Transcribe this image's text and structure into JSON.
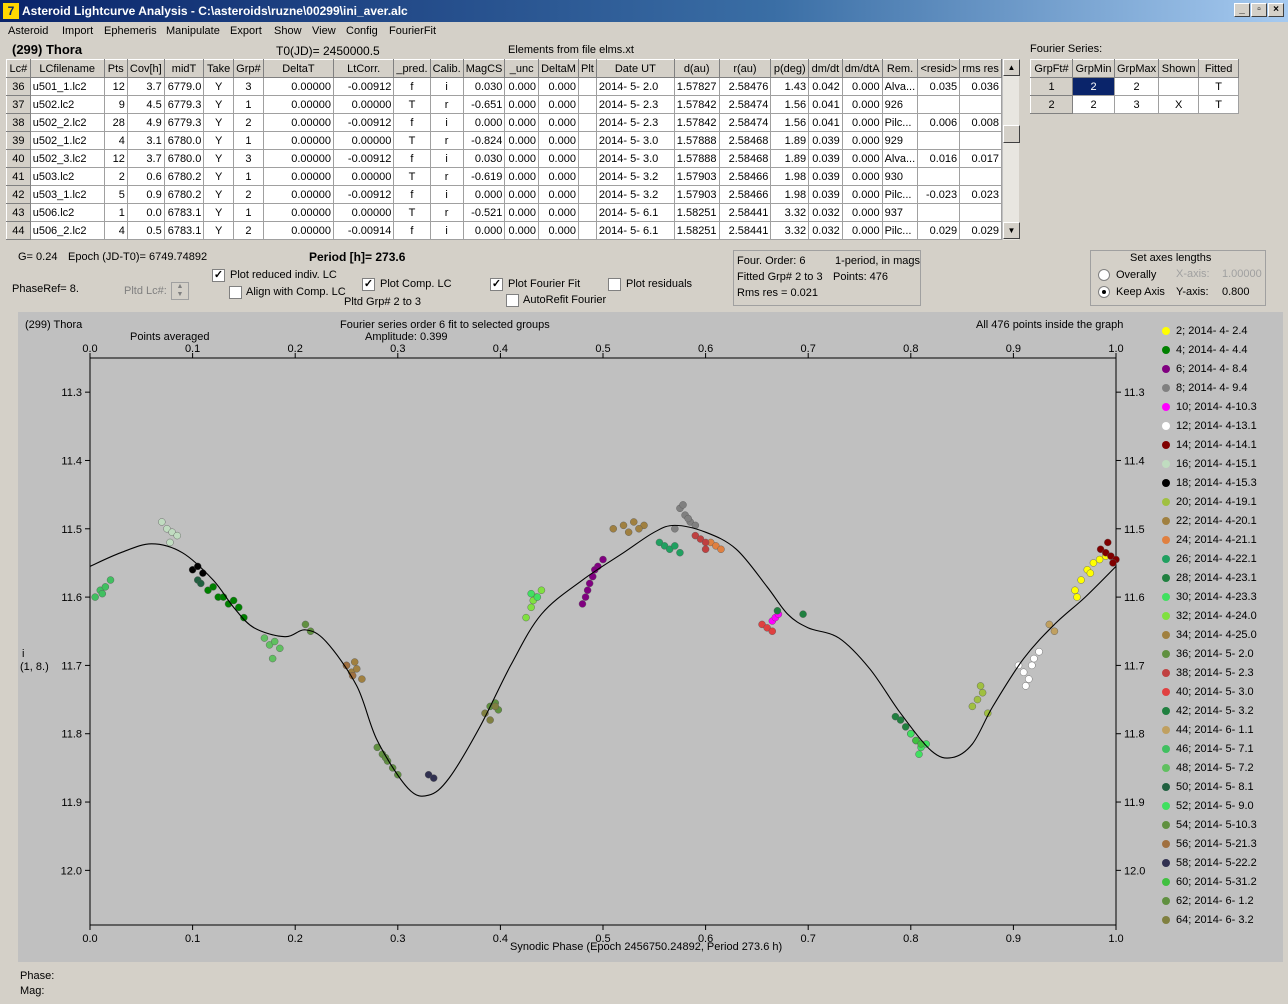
{
  "window": {
    "title": "Asteroid Lightcurve Analysis - C:\\asteroids\\ruzne\\00299\\ini_aver.alc",
    "min": "_",
    "max": "▫",
    "close": "×"
  },
  "menu": [
    "Asteroid",
    "Import",
    "Ephemeris",
    "Manipulate",
    "Export",
    "Show",
    "View",
    "Config",
    "FourierFit"
  ],
  "header": {
    "asteroid": "(299) Thora",
    "t0": "T0(JD)= 2450000.5",
    "elements": "Elements from file elms.xt"
  },
  "table": {
    "columns": [
      "Lc#",
      "LCfilename",
      "Pts",
      "Cov[h]",
      "midT",
      "Take",
      "Grp#",
      "DeltaT",
      "LtCorr.",
      "_pred.",
      "Calib.",
      "MagCS",
      "_unc",
      "DeltaM",
      "Plt",
      "Date UT",
      "d(au)",
      "r(au)",
      "p(deg)",
      "dm/dt",
      "dm/dtA",
      "Rem.",
      "<resid>",
      "rms res"
    ],
    "rows": [
      [
        "36",
        "u501_1.lc2",
        "12",
        "3.7",
        "6779.0",
        "Y",
        "3",
        "0.00000",
        "-0.00912",
        "f",
        "i",
        "0.030",
        "0.000",
        "0.000",
        "",
        "2014- 5- 2.0",
        "1.57827",
        "2.58476",
        "1.43",
        "0.042",
        "0.000",
        "Alva...",
        "0.035",
        "0.036"
      ],
      [
        "37",
        "u502.lc2",
        "9",
        "4.5",
        "6779.3",
        "Y",
        "1",
        "0.00000",
        "0.00000",
        "T",
        "r",
        "-0.651",
        "0.000",
        "0.000",
        "",
        "2014- 5- 2.3",
        "1.57842",
        "2.58474",
        "1.56",
        "0.041",
        "0.000",
        "926",
        "",
        ""
      ],
      [
        "38",
        "u502_2.lc2",
        "28",
        "4.9",
        "6779.3",
        "Y",
        "2",
        "0.00000",
        "-0.00912",
        "f",
        "i",
        "0.000",
        "0.000",
        "0.000",
        "",
        "2014- 5- 2.3",
        "1.57842",
        "2.58474",
        "1.56",
        "0.041",
        "0.000",
        "Pilc...",
        "0.006",
        "0.008"
      ],
      [
        "39",
        "u502_1.lc2",
        "4",
        "3.1",
        "6780.0",
        "Y",
        "1",
        "0.00000",
        "0.00000",
        "T",
        "r",
        "-0.824",
        "0.000",
        "0.000",
        "",
        "2014- 5- 3.0",
        "1.57888",
        "2.58468",
        "1.89",
        "0.039",
        "0.000",
        "929",
        "",
        ""
      ],
      [
        "40",
        "u502_3.lc2",
        "12",
        "3.7",
        "6780.0",
        "Y",
        "3",
        "0.00000",
        "-0.00912",
        "f",
        "i",
        "0.030",
        "0.000",
        "0.000",
        "",
        "2014- 5- 3.0",
        "1.57888",
        "2.58468",
        "1.89",
        "0.039",
        "0.000",
        "Alva...",
        "0.016",
        "0.017"
      ],
      [
        "41",
        "u503.lc2",
        "2",
        "0.6",
        "6780.2",
        "Y",
        "1",
        "0.00000",
        "0.00000",
        "T",
        "r",
        "-0.619",
        "0.000",
        "0.000",
        "",
        "2014- 5- 3.2",
        "1.57903",
        "2.58466",
        "1.98",
        "0.039",
        "0.000",
        "930",
        "",
        ""
      ],
      [
        "42",
        "u503_1.lc2",
        "5",
        "0.9",
        "6780.2",
        "Y",
        "2",
        "0.00000",
        "-0.00912",
        "f",
        "i",
        "0.000",
        "0.000",
        "0.000",
        "",
        "2014- 5- 3.2",
        "1.57903",
        "2.58466",
        "1.98",
        "0.039",
        "0.000",
        "Pilc...",
        "-0.023",
        "0.023"
      ],
      [
        "43",
        "u506.lc2",
        "1",
        "0.0",
        "6783.1",
        "Y",
        "1",
        "0.00000",
        "0.00000",
        "T",
        "r",
        "-0.521",
        "0.000",
        "0.000",
        "",
        "2014- 5- 6.1",
        "1.58251",
        "2.58441",
        "3.32",
        "0.032",
        "0.000",
        "937",
        "",
        ""
      ],
      [
        "44",
        "u506_2.lc2",
        "4",
        "0.5",
        "6783.1",
        "Y",
        "2",
        "0.00000",
        "-0.00914",
        "f",
        "i",
        "0.000",
        "0.000",
        "0.000",
        "",
        "2014- 5- 6.1",
        "1.58251",
        "2.58441",
        "3.32",
        "0.032",
        "0.000",
        "Pilc...",
        "0.029",
        "0.029"
      ]
    ]
  },
  "fourier": {
    "title": "Fourier Series:",
    "columns": [
      "GrpFt#",
      "GrpMin",
      "GrpMax",
      "Shown",
      "Fitted"
    ],
    "rows": [
      [
        "1",
        "2",
        "2",
        "",
        "T"
      ],
      [
        "2",
        "2",
        "3",
        "X",
        "T"
      ]
    ]
  },
  "params": {
    "g": "G= 0.24",
    "epoch": "Epoch (JD-T0)= 6749.74892",
    "period": "Period [h]= 273.6",
    "phaseref": "PhaseRef= 8.",
    "pltd_lc": "Pltd Lc#:",
    "plot_reduced": "Plot reduced indiv. LC",
    "align": "Align with Comp. LC",
    "plot_comp": "Plot Comp. LC",
    "pltd_grp": "Pltd Grp#  2   to    3",
    "plot_fourier": "Plot Fourier Fit",
    "autorefit": "AutoRefit Fourier",
    "plot_resid": "Plot residuals",
    "check_plot_reduced": true,
    "check_align": false,
    "check_plot_comp": true,
    "check_plot_fourier": true,
    "check_autorefit": false,
    "check_plot_resid": false
  },
  "fitinfo": {
    "order": "Four. Order:  6",
    "oneperiod": "1-period, in mags",
    "fitted": "Fitted Grp# 2 to 3",
    "points": "Points: 476",
    "rms": "Rms res    = 0.021"
  },
  "axes": {
    "title": "Set axes lengths",
    "overally": "Overally",
    "keep": "Keep Axis",
    "xaxis": "X-axis:",
    "xval": "1.00000",
    "yaxis": "Y-axis:",
    "yval": "0.800",
    "selected": "keep"
  },
  "chart_data": {
    "type": "scatter",
    "title": "Fourier series order 6 fit to selected groups",
    "subtitle": "Amplitude: 0.399",
    "name": "(299) Thora",
    "note_left": "Points averaged",
    "note_right": "All 476 points inside the graph",
    "xlabel": "Synodic Phase (Epoch 2456750.24892, Period 273.6 h)",
    "ylabel": "i",
    "ylabel2": "(1, 8.)",
    "xlim": [
      0,
      1
    ],
    "ylim": [
      11.25,
      12.08
    ],
    "y_reversed": true,
    "xticks": [
      0.0,
      0.1,
      0.2,
      0.3,
      0.4,
      0.5,
      0.6,
      0.7,
      0.8,
      0.9,
      1.0
    ],
    "yticks": [
      11.3,
      11.4,
      11.5,
      11.6,
      11.7,
      11.8,
      11.9,
      12.0
    ],
    "fit_curve": [
      [
        0,
        11.555
      ],
      [
        0.03,
        11.535
      ],
      [
        0.06,
        11.522
      ],
      [
        0.09,
        11.535
      ],
      [
        0.12,
        11.575
      ],
      [
        0.14,
        11.615
      ],
      [
        0.16,
        11.645
      ],
      [
        0.19,
        11.658
      ],
      [
        0.21,
        11.648
      ],
      [
        0.23,
        11.665
      ],
      [
        0.26,
        11.73
      ],
      [
        0.28,
        11.81
      ],
      [
        0.31,
        11.88
      ],
      [
        0.33,
        11.89
      ],
      [
        0.35,
        11.865
      ],
      [
        0.38,
        11.79
      ],
      [
        0.41,
        11.7
      ],
      [
        0.44,
        11.625
      ],
      [
        0.48,
        11.575
      ],
      [
        0.52,
        11.535
      ],
      [
        0.55,
        11.505
      ],
      [
        0.57,
        11.495
      ],
      [
        0.6,
        11.505
      ],
      [
        0.63,
        11.53
      ],
      [
        0.66,
        11.585
      ],
      [
        0.68,
        11.625
      ],
      [
        0.7,
        11.645
      ],
      [
        0.73,
        11.66
      ],
      [
        0.76,
        11.705
      ],
      [
        0.79,
        11.77
      ],
      [
        0.82,
        11.825
      ],
      [
        0.84,
        11.835
      ],
      [
        0.86,
        11.815
      ],
      [
        0.88,
        11.76
      ],
      [
        0.91,
        11.69
      ],
      [
        0.94,
        11.64
      ],
      [
        0.97,
        11.6
      ],
      [
        1.0,
        11.555
      ]
    ],
    "series": [
      {
        "name": "2; 2014- 4- 2.4",
        "color": "#ffff00",
        "x": [
          0.96,
          0.966,
          0.972,
          0.978,
          0.984,
          0.99,
          0.962,
          0.975
        ],
        "y": [
          11.59,
          11.575,
          11.56,
          11.55,
          11.545,
          11.54,
          11.6,
          11.565
        ]
      },
      {
        "name": "4; 2014- 4- 4.4",
        "color": "#008000",
        "x": [
          0.115,
          0.125,
          0.135,
          0.145,
          0.15,
          0.12,
          0.13,
          0.14
        ],
        "y": [
          11.59,
          11.6,
          11.61,
          11.615,
          11.63,
          11.585,
          11.6,
          11.605
        ]
      },
      {
        "name": "6; 2014- 4- 8.4",
        "color": "#800080",
        "x": [
          0.48,
          0.485,
          0.49,
          0.495,
          0.5,
          0.487,
          0.492,
          0.483
        ],
        "y": [
          11.61,
          11.59,
          11.57,
          11.555,
          11.545,
          11.58,
          11.56,
          11.6
        ]
      },
      {
        "name": "8; 2014- 4- 9.4",
        "color": "#808080",
        "x": [
          0.575,
          0.58,
          0.585,
          0.57,
          0.59,
          0.578,
          0.583
        ],
        "y": [
          11.47,
          11.48,
          11.49,
          11.5,
          11.495,
          11.465,
          11.485
        ]
      },
      {
        "name": "10; 2014- 4-10.3",
        "color": "#ff00ff",
        "x": [
          0.665,
          0.668,
          0.671
        ],
        "y": [
          11.635,
          11.63,
          11.625
        ]
      },
      {
        "name": "12; 2014- 4-13.1",
        "color": "#ffffff",
        "x": [
          0.905,
          0.91,
          0.915,
          0.92,
          0.925,
          0.912,
          0.918
        ],
        "y": [
          11.7,
          11.71,
          11.72,
          11.69,
          11.68,
          11.73,
          11.7
        ]
      },
      {
        "name": "14; 2014- 4-14.1",
        "color": "#800000",
        "x": [
          0.985,
          0.99,
          0.995,
          1.0,
          0.992,
          0.997
        ],
        "y": [
          11.53,
          11.535,
          11.54,
          11.545,
          11.52,
          11.55
        ]
      },
      {
        "name": "16; 2014- 4-15.1",
        "color": "#c0dcc0",
        "x": [
          0.07,
          0.075,
          0.08,
          0.085,
          0.078
        ],
        "y": [
          11.49,
          11.5,
          11.505,
          11.51,
          11.52
        ]
      },
      {
        "name": "18; 2014- 4-15.3",
        "color": "#000000",
        "x": [
          0.1,
          0.105,
          0.11
        ],
        "y": [
          11.56,
          11.555,
          11.565
        ]
      },
      {
        "name": "20; 2014- 4-19.1",
        "color": "#a0c040",
        "x": [
          0.86,
          0.865,
          0.87,
          0.875,
          0.868
        ],
        "y": [
          11.76,
          11.75,
          11.74,
          11.77,
          11.73
        ]
      },
      {
        "name": "22; 2014- 4-20.1",
        "color": "#a08040",
        "x": [
          0.51,
          0.52,
          0.53,
          0.54,
          0.525,
          0.535
        ],
        "y": [
          11.5,
          11.495,
          11.49,
          11.495,
          11.505,
          11.5
        ]
      },
      {
        "name": "24; 2014- 4-21.1",
        "color": "#e08040",
        "x": [
          0.605,
          0.61,
          0.615
        ],
        "y": [
          11.52,
          11.525,
          11.53
        ]
      },
      {
        "name": "26; 2014- 4-22.1",
        "color": "#20a060",
        "x": [
          0.555,
          0.56,
          0.565,
          0.57,
          0.575
        ],
        "y": [
          11.52,
          11.525,
          11.53,
          11.525,
          11.535
        ]
      },
      {
        "name": "28; 2014- 4-23.1",
        "color": "#208040",
        "x": [
          0.785,
          0.79,
          0.795,
          0.8
        ],
        "y": [
          11.775,
          11.78,
          11.79,
          11.8
        ]
      },
      {
        "name": "30; 2014- 4-23.3",
        "color": "#40e060",
        "x": [
          0.8,
          0.805,
          0.81,
          0.815,
          0.808
        ],
        "y": [
          11.8,
          11.81,
          11.82,
          11.815,
          11.83
        ]
      },
      {
        "name": "32; 2014- 4-24.0",
        "color": "#80e040",
        "x": [
          0.425,
          0.43,
          0.435,
          0.44,
          0.432
        ],
        "y": [
          11.63,
          11.615,
          11.6,
          11.59,
          11.605
        ]
      },
      {
        "name": "34; 2014- 4-25.0",
        "color": "#a08040",
        "x": [
          0.25,
          0.255,
          0.26,
          0.265,
          0.258
        ],
        "y": [
          11.7,
          11.71,
          11.705,
          11.72,
          11.695
        ]
      },
      {
        "name": "36; 2014- 5- 2.0",
        "color": "#609040",
        "x": [
          0.28,
          0.285,
          0.29,
          0.295,
          0.3,
          0.288
        ],
        "y": [
          11.82,
          11.83,
          11.84,
          11.85,
          11.86,
          11.835
        ]
      },
      {
        "name": "38; 2014- 5- 2.3",
        "color": "#c04040",
        "x": [
          0.59,
          0.595,
          0.6,
          0.6
        ],
        "y": [
          11.51,
          11.515,
          11.52,
          11.53
        ]
      },
      {
        "name": "40; 2014- 5- 3.0",
        "color": "#e04040",
        "x": [
          0.655,
          0.66,
          0.665
        ],
        "y": [
          11.64,
          11.645,
          11.65
        ]
      },
      {
        "name": "42; 2014- 5- 3.2",
        "color": "#208040",
        "x": [
          0.67,
          0.695
        ],
        "y": [
          11.62,
          11.625
        ]
      },
      {
        "name": "44; 2014- 6- 1.1",
        "color": "#c0a060",
        "x": [
          0.935,
          0.94
        ],
        "y": [
          11.64,
          11.65
        ]
      },
      {
        "name": "46; 2014- 5- 7.1",
        "color": "#40c060",
        "x": [
          0.005,
          0.01,
          0.015,
          0.02,
          0.012
        ],
        "y": [
          11.6,
          11.59,
          11.585,
          11.575,
          11.595
        ]
      },
      {
        "name": "48; 2014- 5- 7.2",
        "color": "#60c060",
        "x": [
          0.17,
          0.175,
          0.18,
          0.185,
          0.178
        ],
        "y": [
          11.66,
          11.67,
          11.665,
          11.675,
          11.69
        ]
      },
      {
        "name": "50; 2014- 5- 8.1",
        "color": "#206040",
        "x": [
          0.105,
          0.108
        ],
        "y": [
          11.575,
          11.58
        ]
      },
      {
        "name": "52; 2014- 5- 9.0",
        "color": "#40e060",
        "x": [
          0.43,
          0.436
        ],
        "y": [
          11.595,
          11.6
        ]
      },
      {
        "name": "54; 2014- 5-10.3",
        "color": "#609040",
        "x": [
          0.21,
          0.215
        ],
        "y": [
          11.64,
          11.65
        ]
      },
      {
        "name": "56; 2014- 5-21.3",
        "color": "#a07040",
        "x": [
          0.25,
          0.256
        ],
        "y": [
          11.7,
          11.715
        ]
      },
      {
        "name": "58; 2014- 5-22.2",
        "color": "#303050",
        "x": [
          0.33,
          0.335
        ],
        "y": [
          11.86,
          11.865
        ]
      },
      {
        "name": "60; 2014- 5-31.2",
        "color": "#40c040",
        "x": [
          0.805,
          0.81
        ],
        "y": [
          11.81,
          11.815
        ]
      },
      {
        "name": "62; 2014- 6- 1.2",
        "color": "#609040",
        "x": [
          0.39,
          0.395,
          0.398
        ],
        "y": [
          11.76,
          11.755,
          11.765
        ]
      },
      {
        "name": "64; 2014- 6- 3.2",
        "color": "#808040",
        "x": [
          0.385,
          0.39,
          0.395
        ],
        "y": [
          11.77,
          11.78,
          11.76
        ]
      }
    ]
  },
  "status": {
    "phase": "Phase:",
    "mag": "Mag:"
  }
}
